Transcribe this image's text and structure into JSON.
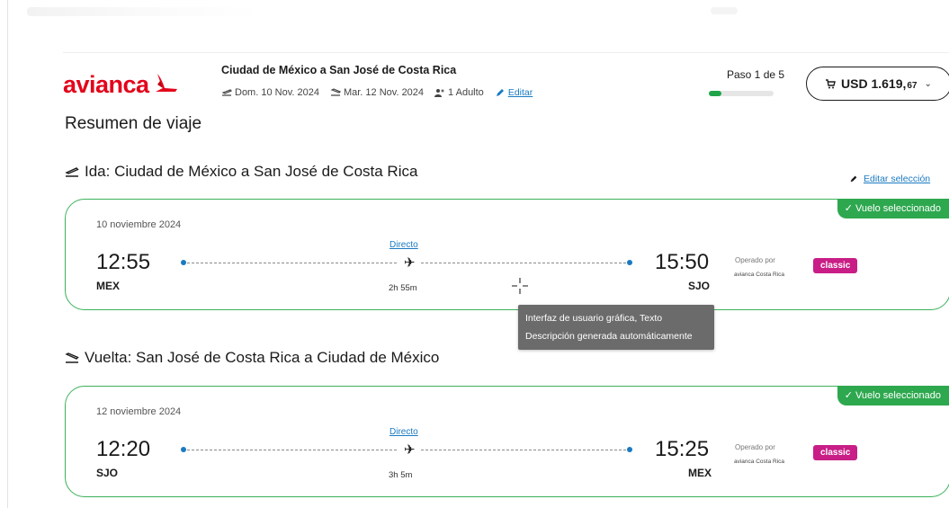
{
  "brand": {
    "name": "avianca",
    "color": "#e3051b"
  },
  "header": {
    "route_title": "Ciudad de México a San José de Costa Rica",
    "depart_date": "Dom. 10 Nov. 2024",
    "return_date": "Mar. 12 Nov. 2024",
    "passengers": "1 Adulto",
    "edit_label": "Editar",
    "step_label": "Paso 1 de 5",
    "step_progress": 0.2,
    "cart": {
      "icon": "cart-icon",
      "price_main": "USD 1.619,",
      "price_decimals": "67",
      "chevron": "⌄"
    }
  },
  "page_title": "Resumen de viaje",
  "edit_selection_label": "Editar selección",
  "flights": [
    {
      "section_title": "Ida: Ciudad de México a San José de Costa Rica",
      "date": "10 noviembre 2024",
      "depart_time": "12:55",
      "depart_code": "MEX",
      "arrive_time": "15:50",
      "arrive_code": "SJO",
      "stops": "Directo",
      "duration": "2h 55m",
      "operated_by_label": "Operado por",
      "operator": "avianca Costa Rica",
      "fare": "classic",
      "badge": "✓ Vuelo seleccionado"
    },
    {
      "section_title": "Vuelta: San José de Costa Rica a Ciudad de México",
      "date": "12 noviembre 2024",
      "depart_time": "12:20",
      "depart_code": "SJO",
      "arrive_time": "15:25",
      "arrive_code": "MEX",
      "stops": "Directo",
      "duration": "3h 5m",
      "operated_by_label": "Operado por",
      "operator": "avianca Costa Rica",
      "fare": "classic",
      "badge": "✓ Vuelo seleccionado"
    }
  ],
  "tooltip": {
    "line1": "Interfaz de usuario gráfica, Texto",
    "line2": "Descripción generada automáticamente"
  },
  "colors": {
    "accent_blue": "#1a7ac2",
    "selected_green": "#2ea84f",
    "fare_magenta": "#c81e86"
  }
}
